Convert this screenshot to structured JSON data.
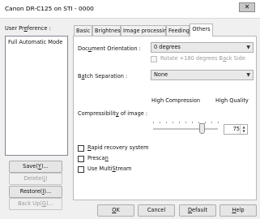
{
  "window": {
    "title": "Canon DR-C125 on STI - 0000",
    "close_glyph": "✕"
  },
  "sidebar": {
    "preference_label": "User Preference :",
    "preferences": [
      "Full Automatic Mode"
    ],
    "buttons": {
      "save": "Save(Y)...",
      "delete": "Delete(J)",
      "restore": "Restore(I)...",
      "backup": "Back Up(G)..."
    }
  },
  "tabs": [
    {
      "label": "Basic",
      "active": false
    },
    {
      "label": "Brightness",
      "active": false
    },
    {
      "label": "Image processing",
      "active": false
    },
    {
      "label": "Feeding",
      "active": false
    },
    {
      "label": "Others",
      "active": true
    }
  ],
  "others": {
    "document_orientation": {
      "label": "Document Orientation :",
      "value": "0 degrees",
      "rotate_label": "Rotate +180 degrees Back Side",
      "rotate_checked": false,
      "rotate_enabled": false
    },
    "batch_separation": {
      "label": "Batch Separation :",
      "value": "None"
    },
    "compressibility": {
      "label": "Compressibility of image :",
      "min_label": "High Compression",
      "max_label": "High Quality",
      "value": "75",
      "slider_fraction": 0.75
    },
    "checkboxes": [
      {
        "label": "Rapid recovery system",
        "checked": false
      },
      {
        "label": "Prescan",
        "checked": false
      },
      {
        "label": "Use MultiStream",
        "checked": false
      }
    ]
  },
  "footer": {
    "ok": "OK",
    "cancel": "Cancel",
    "default": "Default",
    "help": "Help"
  }
}
